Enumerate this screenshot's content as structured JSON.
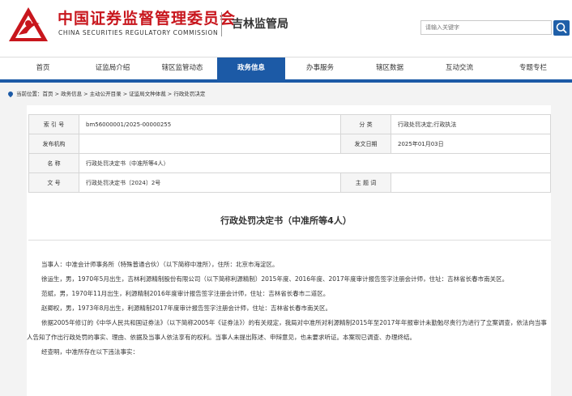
{
  "header": {
    "cn_title": "中国证券监督管理委员会",
    "en_title": "CHINA SECURITIES REGULATORY COMMISSION",
    "sub_title": "吉林监管局",
    "search_placeholder": "请输入关键字",
    "brand_color": "#c8161d",
    "accent_color": "#1c5aa6"
  },
  "nav": {
    "items": [
      "首页",
      "证监局介绍",
      "辖区监管动态",
      "政务信息",
      "办事服务",
      "辖区数据",
      "互动交流",
      "专题专栏"
    ],
    "active": "政务信息"
  },
  "breadcrumb": {
    "prefix": "当前位置：",
    "path": "首页 > 政务信息 > 主动公开目录 > 证监局文种体裁 > 行政处罚决定"
  },
  "meta": {
    "index_label": "索 引 号",
    "index_value": "bm56000001/2025-00000255",
    "category_label": "分 类",
    "category_value": "行政处罚决定;行政执法",
    "issuer_label": "发布机构",
    "issuer_value": "",
    "date_label": "发文日期",
    "date_value": "2025年01月03日",
    "name_label": "名 称",
    "name_value": "行政处罚决定书（中准所等4人）",
    "docno_label": "文 号",
    "docno_value": "行政处罚决定书〔2024〕2号",
    "subject_label": "主 题 词",
    "subject_value": ""
  },
  "document": {
    "title": "行政处罚决定书（中准所等4人）",
    "paragraphs": [
      "当事人：中准会计师事务所（特殊普通合伙）（以下简称中准所），住所：北京市海淀区。",
      "徐运生，男，1970年5月出生，吉林利源精制股份有限公司（以下简称利源精制）2015年度、2016年度、2017年度审计报告签字注册会计师，住址：吉林省长春市南关区。",
      "范斌，男，1970年11月出生，利源精制2016年度审计报告签字注册会计师，住址：吉林省长春市二道区。",
      "赵卿权，男，1973年8月出生，利源精制2017年度审计报告签字注册会计师，住址：吉林省长春市南关区。",
      "依据2005年修订的《中华人民共和国证券法》（以下简称2005年《证券法》）的有关规定，我局对中准所对利源精制2015年至2017年年报审计未勤勉尽责行为进行了立案调查，依法向当事人告知了作出行政处罚的事实、理由、依据及当事人依法享有的权利。当事人未提出陈述、申辩意见，也未要求听证。本案现已调查、办理终结。",
      "经查明，中准所存在以下违法事实："
    ]
  }
}
